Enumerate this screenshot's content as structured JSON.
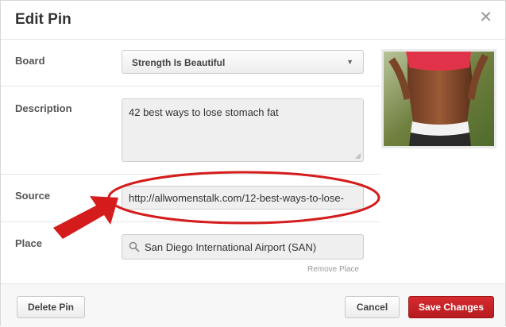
{
  "dialog": {
    "title": "Edit Pin",
    "close_glyph": "✕"
  },
  "board": {
    "label": "Board",
    "selected": "Strength Is Beautiful",
    "arrow_glyph": "▼"
  },
  "description": {
    "label": "Description",
    "value": "42 best ways to lose stomach fat"
  },
  "source": {
    "label": "Source",
    "value": "http://allwomenstalk.com/12-best-ways-to-lose-"
  },
  "place": {
    "label": "Place",
    "value": "San Diego International Airport (SAN)",
    "remove_label": "Remove Place"
  },
  "footer": {
    "delete_label": "Delete Pin",
    "cancel_label": "Cancel",
    "save_label": "Save Changes"
  },
  "colors": {
    "save_button": "#c4222a",
    "annotation_red": "#d41c1c"
  },
  "icons": {
    "close": "close-icon",
    "dropdown": "chevron-down-icon",
    "search": "search-icon"
  }
}
